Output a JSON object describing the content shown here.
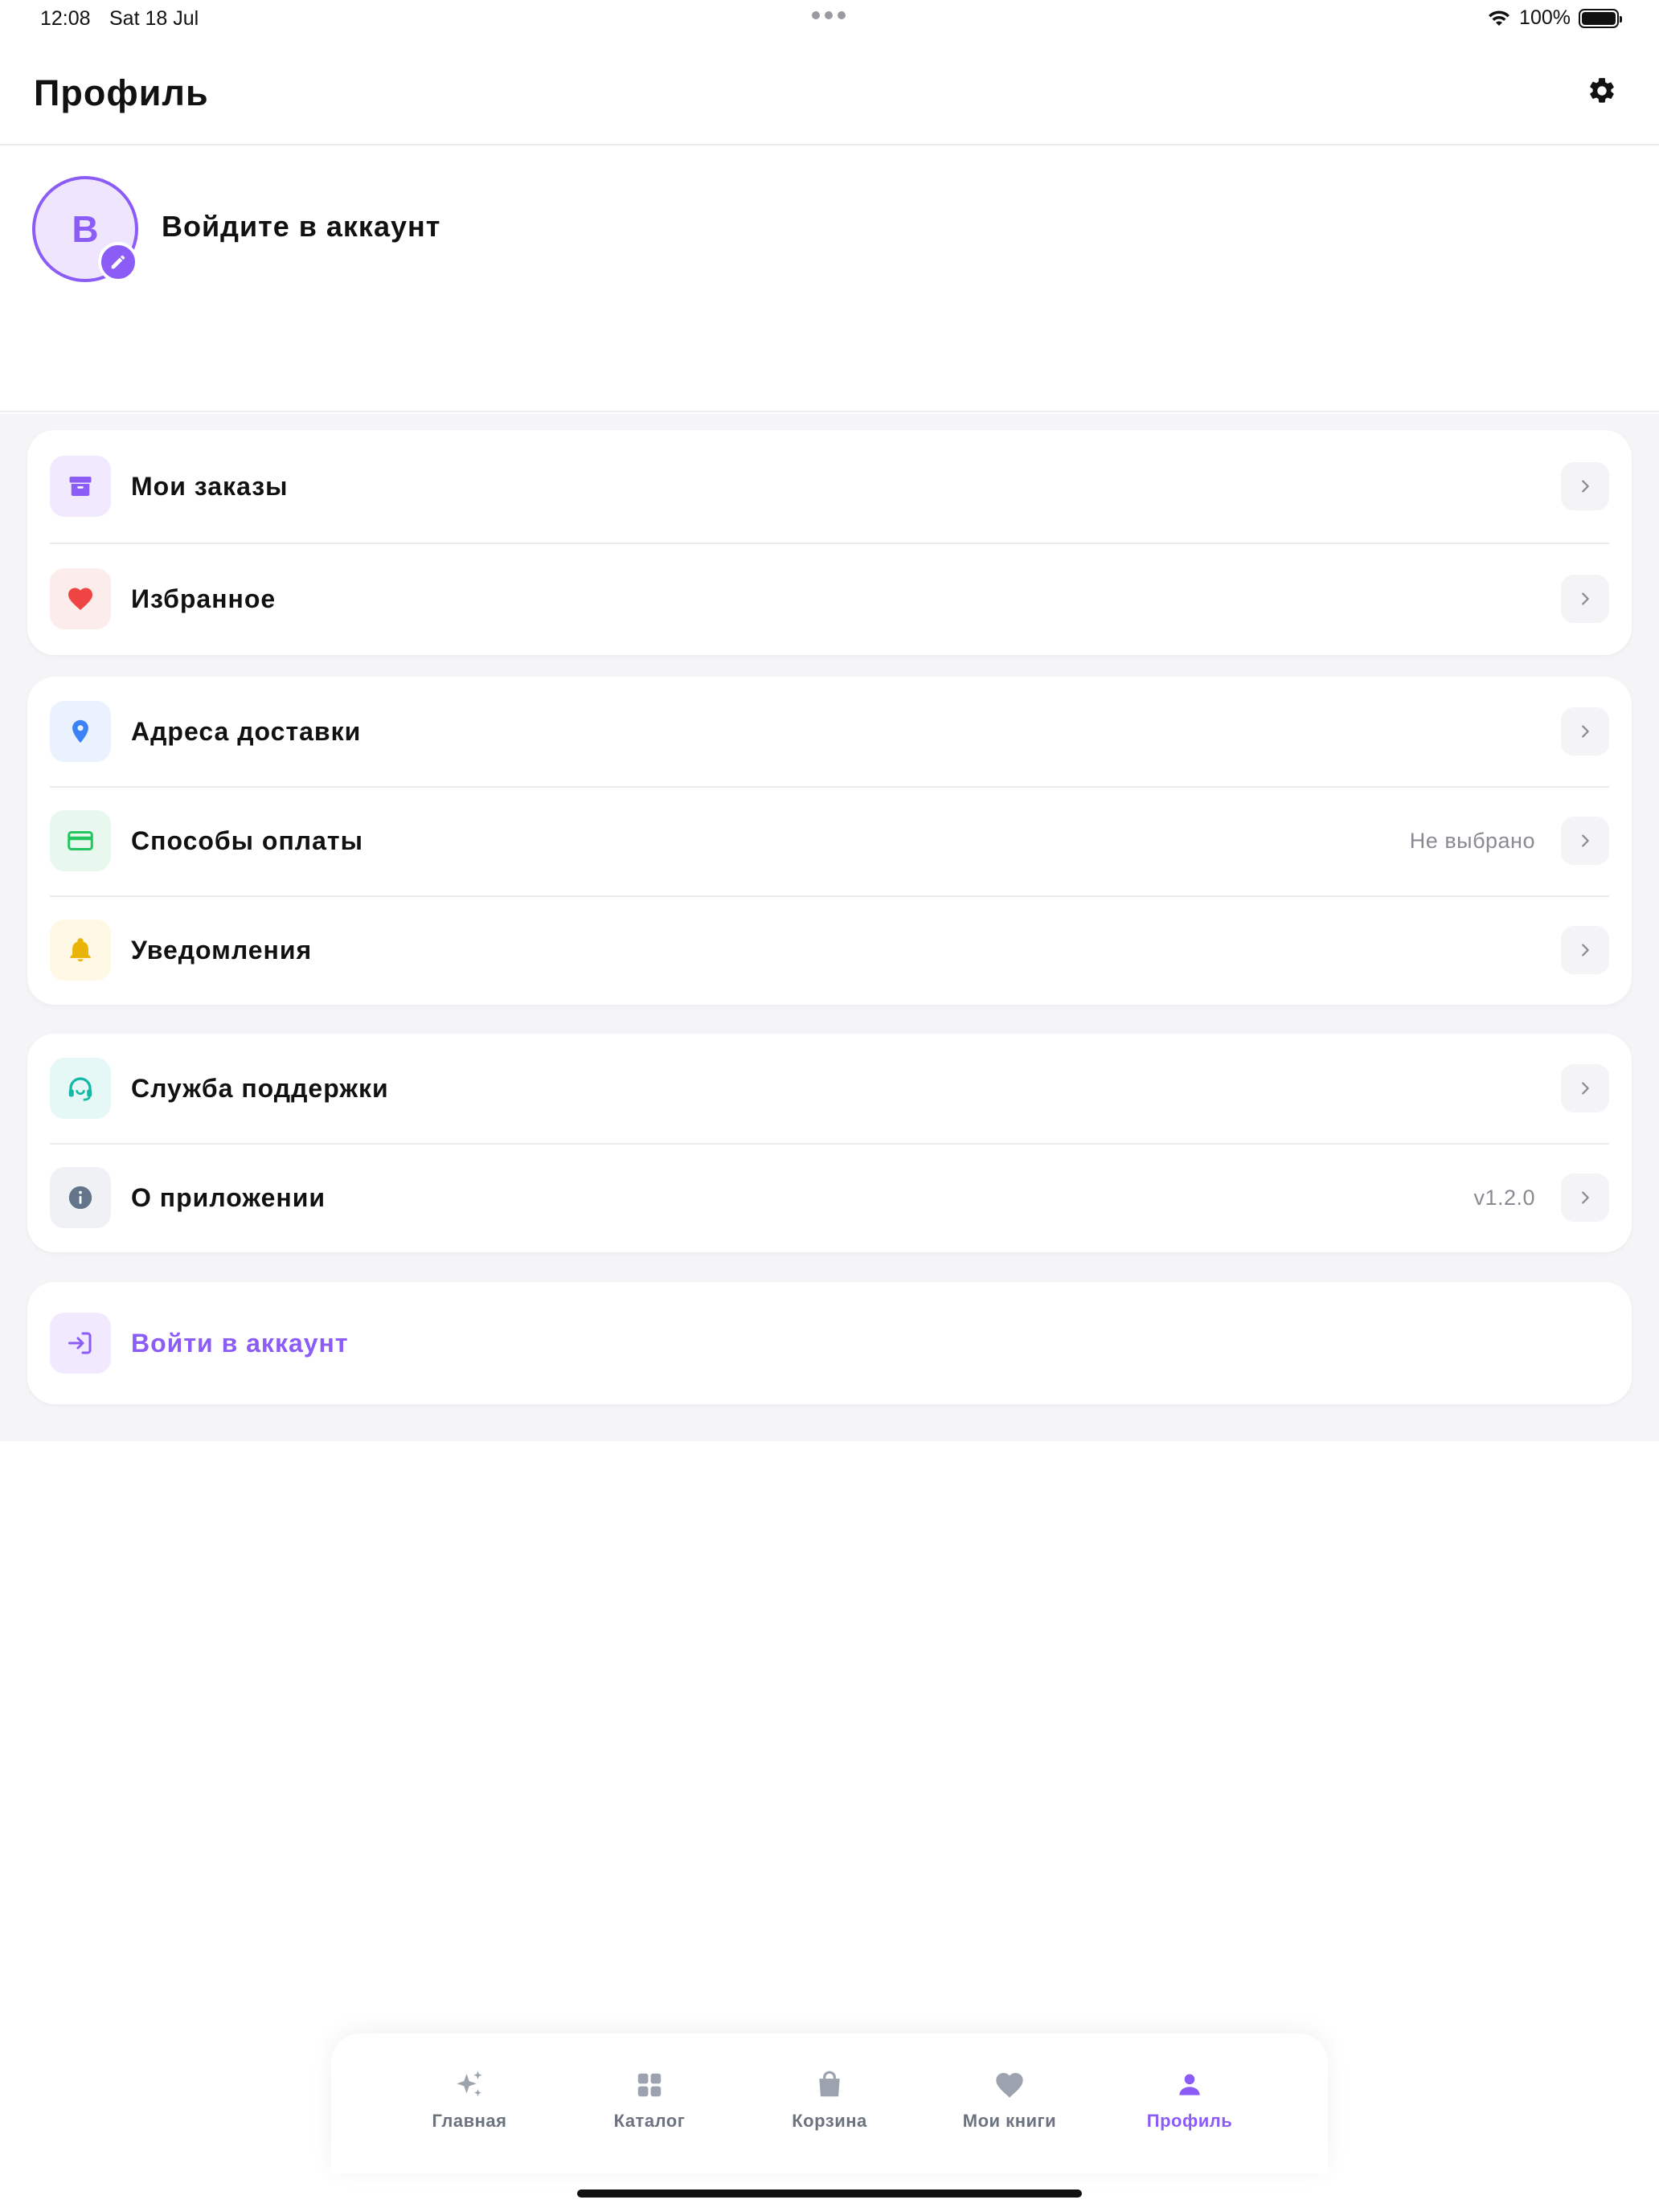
{
  "status_bar": {
    "time": "12:08",
    "date": "Sat 18 Jul",
    "battery": "100%"
  },
  "header": {
    "title": "Профиль"
  },
  "profile": {
    "avatar_letter": "В",
    "prompt": "Войдите в аккаунт"
  },
  "groups": [
    {
      "items": [
        {
          "label": "Мои заказы",
          "value": "",
          "icon": "archive-icon"
        },
        {
          "label": "Избранное",
          "value": "",
          "icon": "heart-icon"
        }
      ]
    },
    {
      "items": [
        {
          "label": "Адреса доставки",
          "value": "",
          "icon": "location-pin-icon"
        },
        {
          "label": "Способы оплаты",
          "value": "Не выбрано",
          "icon": "credit-card-icon"
        },
        {
          "label": "Уведомления",
          "value": "",
          "icon": "bell-icon"
        }
      ]
    },
    {
      "items": [
        {
          "label": "Служба поддержки",
          "value": "",
          "icon": "headset-icon"
        },
        {
          "label": "О приложении",
          "value": "v1.2.0",
          "icon": "info-icon"
        }
      ]
    }
  ],
  "login": {
    "label": "Войти в аккаунт",
    "icon": "login-icon"
  },
  "tabbar": {
    "tabs": [
      {
        "label": "Главная",
        "icon": "sparkles-icon",
        "active": false
      },
      {
        "label": "Каталог",
        "icon": "grid-icon",
        "active": false
      },
      {
        "label": "Корзина",
        "icon": "shopping-bag-icon",
        "active": false
      },
      {
        "label": "Мои книги",
        "icon": "heart-icon",
        "active": false
      },
      {
        "label": "Профиль",
        "icon": "person-icon",
        "active": true
      }
    ]
  },
  "colors": {
    "accent": "#8b5cf6",
    "heart": "#ef4444",
    "pin": "#3b82f6",
    "card": "#22c55e",
    "bell": "#eab308",
    "support": "#14b8a6",
    "info": "#64748b",
    "background": "#f5f5f8"
  }
}
